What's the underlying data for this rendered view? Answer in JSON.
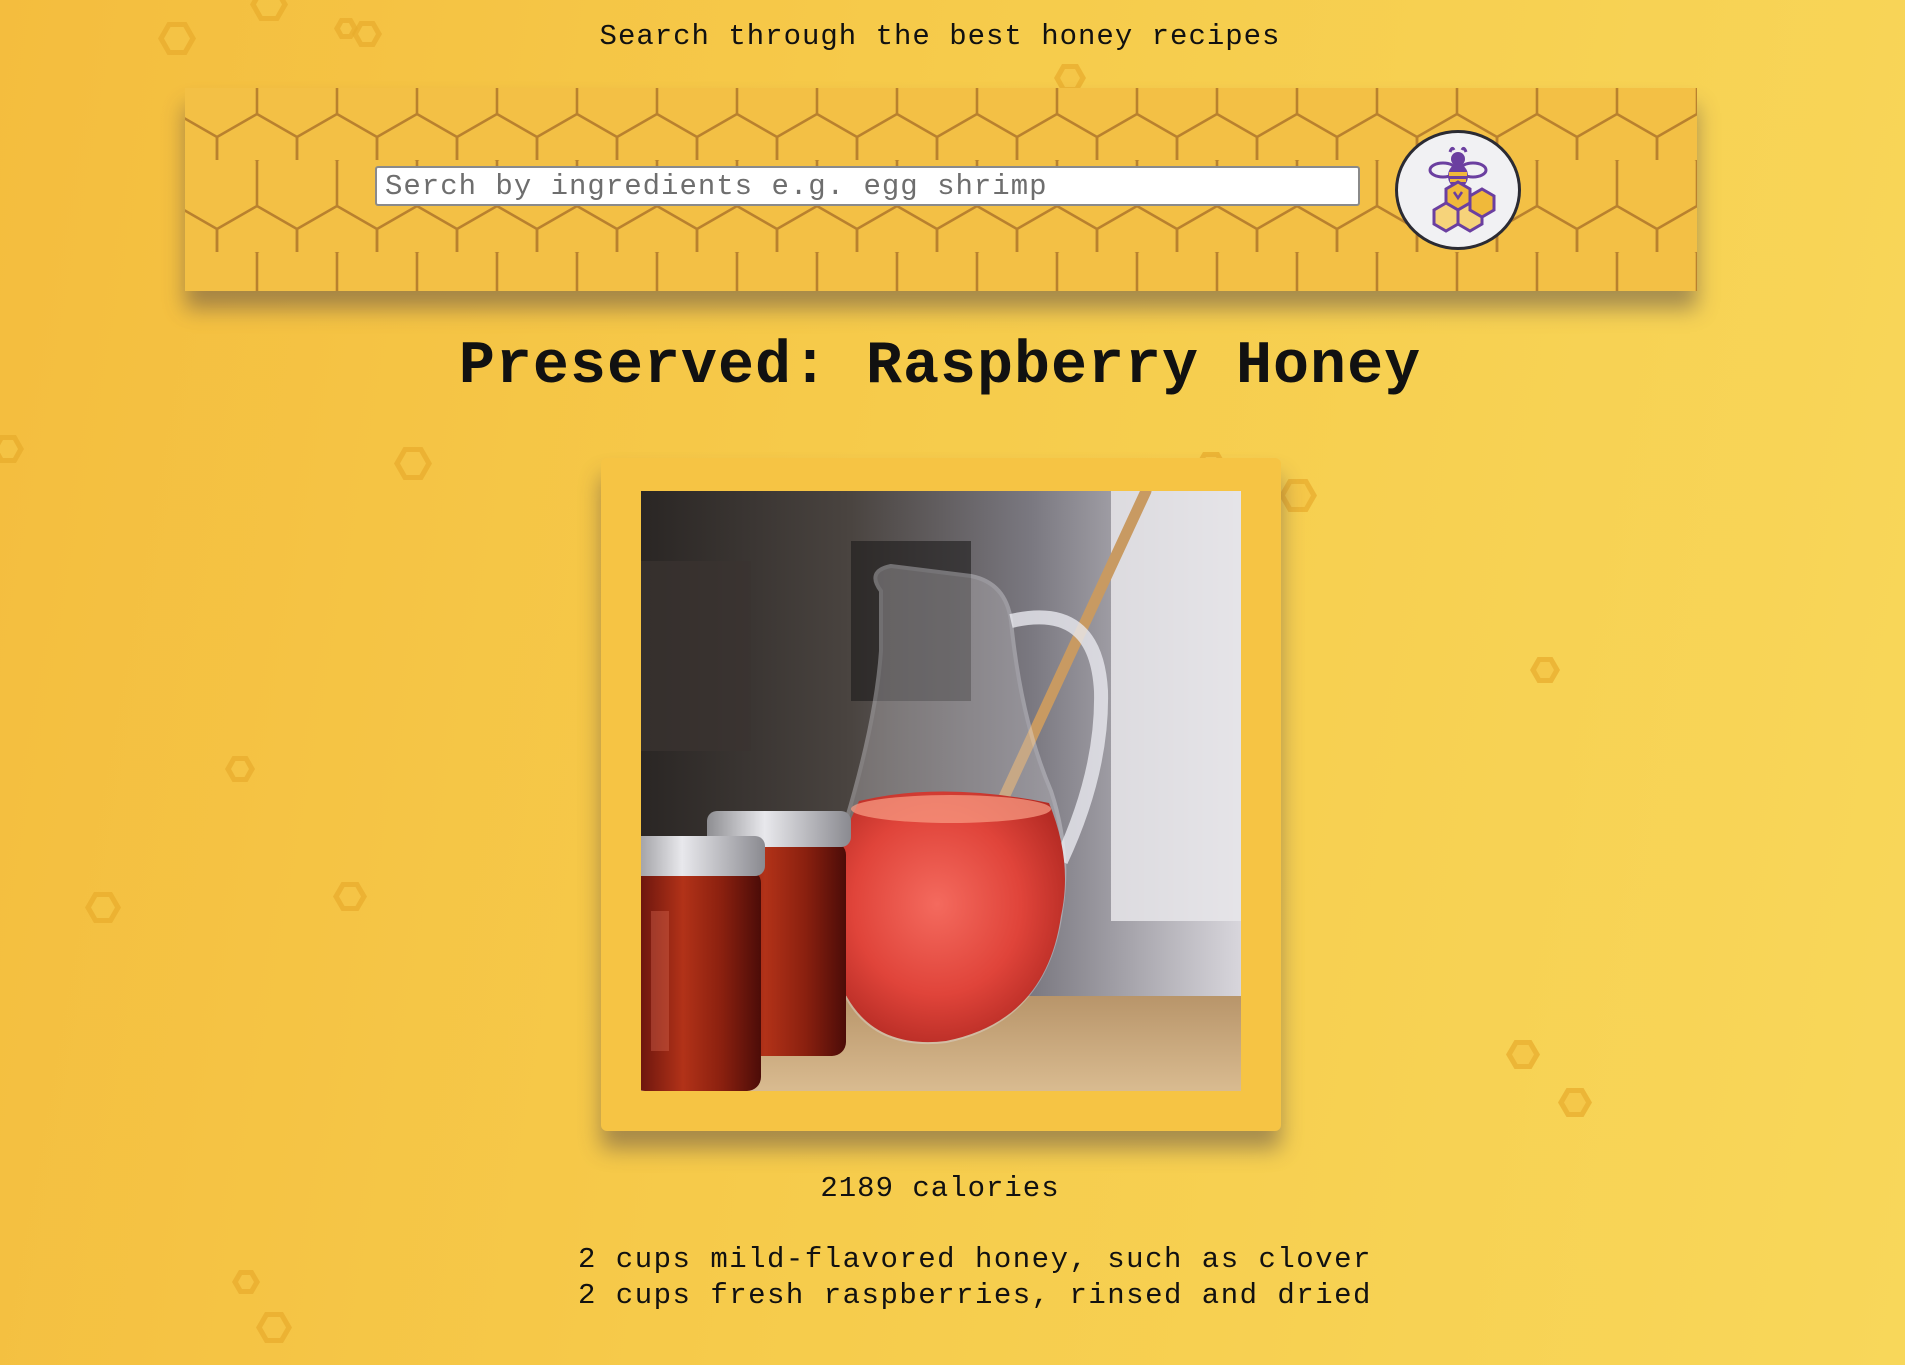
{
  "header": {
    "tagline": "Search through the best honey recipes"
  },
  "search": {
    "placeholder": "Serch by ingredients e.g. egg shrimp",
    "value": "",
    "logo_icon": "bee-honeycomb-icon"
  },
  "recipe": {
    "title": "Preserved: Raspberry Honey",
    "image_icon": "raspberry-honey-photo",
    "calories": "2189 calories",
    "ingredients": [
      "2 cups mild-flavored honey, such as clover",
      "2 cups fresh raspberries, rinsed and dried"
    ]
  },
  "colors": {
    "background_start": "#f4bd3e",
    "background_end": "#f8d75a",
    "banner": "#f3c045",
    "comb_line": "#b9812e",
    "logo_purple": "#6b3fa0",
    "logo_gold": "#f0b93a"
  }
}
